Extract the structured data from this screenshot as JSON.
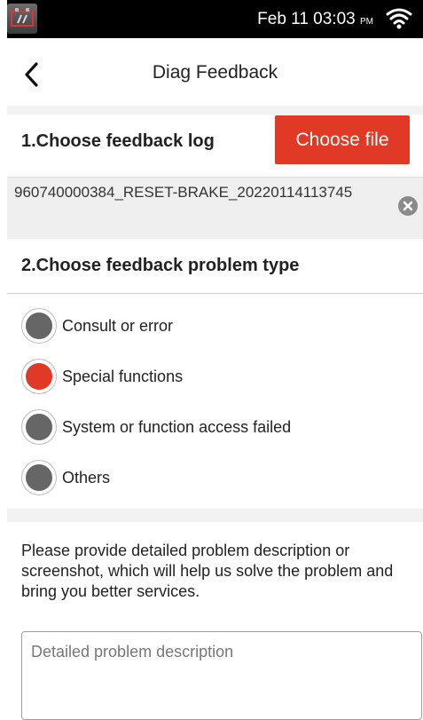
{
  "status_bar": {
    "date": "Feb 11",
    "time": "03:03",
    "ampm": "PM",
    "icons": [
      "battery-app-icon",
      "wifi-icon"
    ]
  },
  "header": {
    "back_icon": "chevron-left-icon",
    "title": "Diag Feedback"
  },
  "log_section": {
    "title": "1.Choose feedback log",
    "choose_button": "Choose file",
    "file_name": "960740000384_RESET-BRAKE_20220114113745",
    "remove_icon": "close-circle-icon"
  },
  "problem_type": {
    "title": "2.Choose feedback problem type",
    "options": [
      {
        "label": "Consult or error",
        "selected": false
      },
      {
        "label": "Special functions",
        "selected": true
      },
      {
        "label": "System or function access failed",
        "selected": false
      },
      {
        "label": "Others",
        "selected": false
      }
    ]
  },
  "description": {
    "text": "Please provide detailed problem description or screenshot, which will help us solve the problem and bring you better services.",
    "placeholder": "Detailed problem description",
    "value": ""
  },
  "colors": {
    "accent": "#e03a27",
    "radio_unselected": "#666666",
    "status_bar": "#000000",
    "section_gap": "#f2f2f2"
  }
}
